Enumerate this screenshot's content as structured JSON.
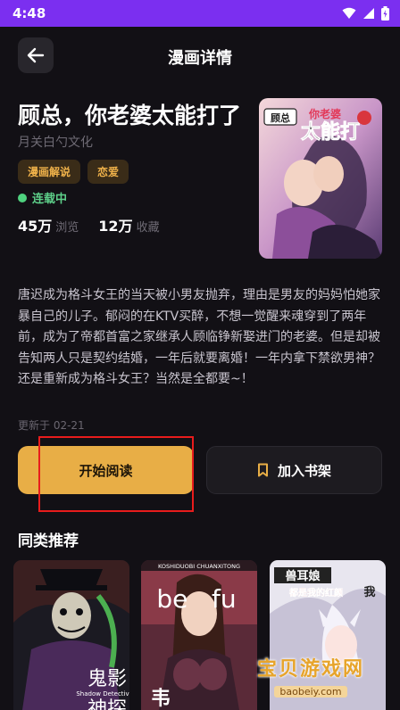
{
  "status_bar": {
    "time": "4:48"
  },
  "header": {
    "title": "漫画详情"
  },
  "comic": {
    "title": "顾总，你老婆太能打了",
    "publisher": "月关白勺文化",
    "tags": [
      "漫画解说",
      "恋爱"
    ],
    "status": "连载中",
    "views": {
      "value": "45万",
      "label": "浏览"
    },
    "favorites": {
      "value": "12万",
      "label": "收藏"
    },
    "cover_text": [
      "顾总",
      "你老婆",
      "太能打"
    ],
    "description": "唐迟成为格斗女王的当天被小男友抛弃，理由是男友的妈妈怕她家暴自己的儿子。郁闷的在KTV买醉，不想一觉醒来魂穿到了两年前，成为了帝都首富之家继承人顾临铮新娶进门的老婆。但是却被告知两人只是契约结婚，一年后就要离婚！一年内拿下禁欲男神？还是重新成为格斗女王？当然是全都要~！",
    "updated": "更新于 02-21"
  },
  "actions": {
    "read": "开始阅读",
    "add_shelf": "加入书架"
  },
  "recommend": {
    "title": "同类推荐",
    "items": [
      {
        "title_big": "鬼影",
        "subtitle": "Shadow Detectiv",
        "extra": "神探"
      },
      {
        "top_text": "KOSHIDUOBI  CHUANXITONG",
        "big_text": "be   fu",
        "extra": "韦"
      },
      {
        "title": "兽耳娘",
        "subtitle": "都是我的红颜",
        "extra": "我"
      }
    ]
  },
  "watermark": {
    "big": "宝贝游戏网",
    "small": "baobeiy.com"
  },
  "colors": {
    "accent": "#e8ae46",
    "status_bar": "#7b2ff0",
    "live": "#4fd27f",
    "highlight": "#e81c1c"
  }
}
